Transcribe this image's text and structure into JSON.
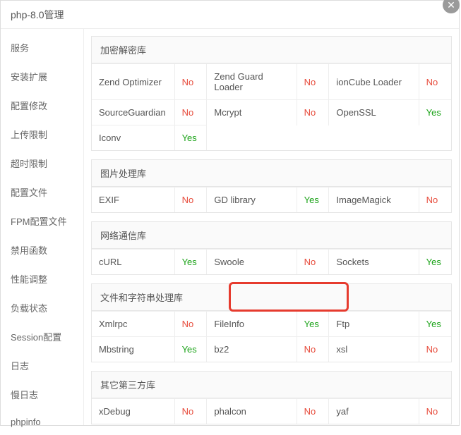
{
  "title": "php-8.0管理",
  "close_glyph": "✕",
  "sidebar": {
    "items": [
      "服务",
      "安装扩展",
      "配置修改",
      "上传限制",
      "超时限制",
      "配置文件",
      "FPM配置文件",
      "禁用函数",
      "性能调整",
      "负载状态",
      "Session配置",
      "日志",
      "慢日志",
      "phpinfo"
    ]
  },
  "sections": [
    {
      "title": "加密解密库",
      "rows": [
        [
          [
            "Zend Optimizer",
            "No"
          ],
          [
            "Zend Guard Loader",
            "No"
          ],
          [
            "ionCube Loader",
            "No"
          ]
        ],
        [
          [
            "SourceGuardian",
            "No"
          ],
          [
            "Mcrypt",
            "No"
          ],
          [
            "OpenSSL",
            "Yes"
          ]
        ],
        [
          [
            "Iconv",
            "Yes"
          ]
        ]
      ]
    },
    {
      "title": "图片处理库",
      "rows": [
        [
          [
            "EXIF",
            "No"
          ],
          [
            "GD library",
            "Yes"
          ],
          [
            "ImageMagick",
            "No"
          ]
        ]
      ]
    },
    {
      "title": "网络通信库",
      "rows": [
        [
          [
            "cURL",
            "Yes"
          ],
          [
            "Swoole",
            "No"
          ],
          [
            "Sockets",
            "Yes"
          ]
        ]
      ]
    },
    {
      "title": "文件和字符串处理库",
      "rows": [
        [
          [
            "Xmlrpc",
            "No"
          ],
          [
            "FileInfo",
            "Yes"
          ],
          [
            "Ftp",
            "Yes"
          ]
        ],
        [
          [
            "Mbstring",
            "Yes"
          ],
          [
            "bz2",
            "No"
          ],
          [
            "xsl",
            "No"
          ]
        ]
      ]
    },
    {
      "title": "其它第三方库",
      "rows": [
        [
          [
            "xDebug",
            "No"
          ],
          [
            "phalcon",
            "No"
          ],
          [
            "yaf",
            "No"
          ]
        ]
      ]
    }
  ]
}
